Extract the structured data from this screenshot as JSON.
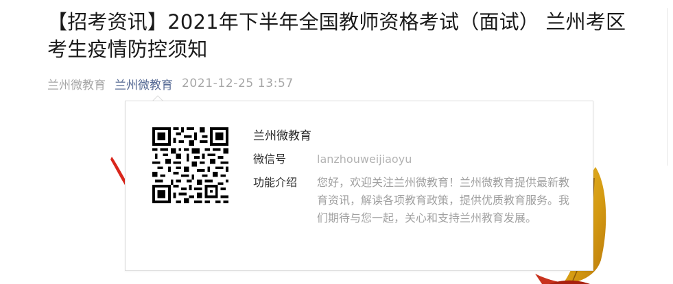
{
  "article": {
    "title": "【招考资讯】2021年下半年全国教师资格考试（面试） 兰州考区考生疫情防控须知",
    "author": "兰州微教育",
    "account_name": "兰州微教育",
    "publish_time": "2021-12-25 13:57"
  },
  "profile_card": {
    "name": "兰州微教育",
    "wechat_id_label": "微信号",
    "wechat_id": "lanzhouweijiaoyu",
    "intro_label": "功能介绍",
    "intro": "您好，欢迎关注兰州微教育！兰州微教育提供最新教育资讯，解读各项教育政策，提供优质教育服务。我们期待与您一起，关心和支持兰州教育发展。"
  },
  "colors": {
    "link": "#576b95",
    "muted": "#a6a6a6",
    "accent_red": "#d9261c",
    "leaf_gold": "#d9a31a"
  }
}
